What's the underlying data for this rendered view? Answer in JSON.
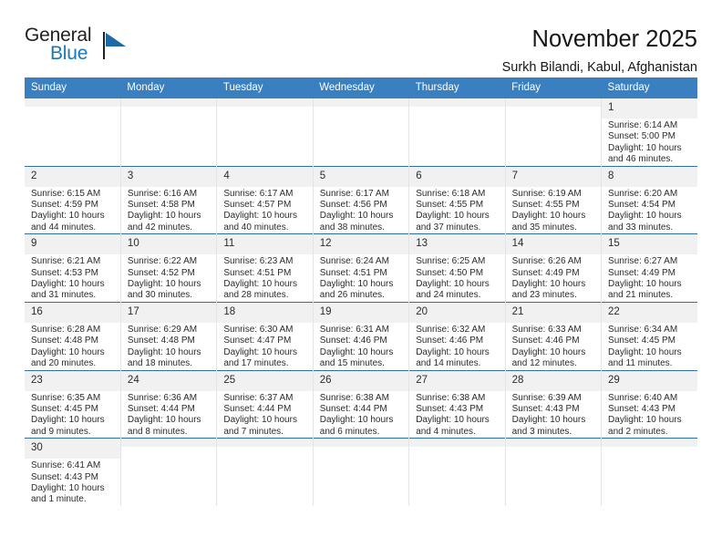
{
  "brand": {
    "name_part1": "General",
    "name_part2": "Blue",
    "mark_icon": "blue-triangle-icon"
  },
  "header": {
    "title": "November 2025",
    "subtitle": "Surkh Bilandi, Kabul, Afghanistan"
  },
  "colors": {
    "header_blue": "#3a7fbf",
    "row_divider_blue": "#2f6da8",
    "daynum_bg": "#f1f1f1",
    "brand_blue": "#1878be",
    "text": "#2b2b2b"
  },
  "calendar": {
    "weekday_headers": [
      "Sunday",
      "Monday",
      "Tuesday",
      "Wednesday",
      "Thursday",
      "Friday",
      "Saturday"
    ],
    "weeks": [
      [
        {
          "day": "",
          "empty": true
        },
        {
          "day": "",
          "empty": true
        },
        {
          "day": "",
          "empty": true
        },
        {
          "day": "",
          "empty": true
        },
        {
          "day": "",
          "empty": true
        },
        {
          "day": "",
          "empty": true
        },
        {
          "day": "1",
          "sunrise": "Sunrise: 6:14 AM",
          "sunset": "Sunset: 5:00 PM",
          "daylight_line1": "Daylight: 10 hours",
          "daylight_line2": "and 46 minutes."
        }
      ],
      [
        {
          "day": "2",
          "sunrise": "Sunrise: 6:15 AM",
          "sunset": "Sunset: 4:59 PM",
          "daylight_line1": "Daylight: 10 hours",
          "daylight_line2": "and 44 minutes."
        },
        {
          "day": "3",
          "sunrise": "Sunrise: 6:16 AM",
          "sunset": "Sunset: 4:58 PM",
          "daylight_line1": "Daylight: 10 hours",
          "daylight_line2": "and 42 minutes."
        },
        {
          "day": "4",
          "sunrise": "Sunrise: 6:17 AM",
          "sunset": "Sunset: 4:57 PM",
          "daylight_line1": "Daylight: 10 hours",
          "daylight_line2": "and 40 minutes."
        },
        {
          "day": "5",
          "sunrise": "Sunrise: 6:17 AM",
          "sunset": "Sunset: 4:56 PM",
          "daylight_line1": "Daylight: 10 hours",
          "daylight_line2": "and 38 minutes."
        },
        {
          "day": "6",
          "sunrise": "Sunrise: 6:18 AM",
          "sunset": "Sunset: 4:55 PM",
          "daylight_line1": "Daylight: 10 hours",
          "daylight_line2": "and 37 minutes."
        },
        {
          "day": "7",
          "sunrise": "Sunrise: 6:19 AM",
          "sunset": "Sunset: 4:55 PM",
          "daylight_line1": "Daylight: 10 hours",
          "daylight_line2": "and 35 minutes."
        },
        {
          "day": "8",
          "sunrise": "Sunrise: 6:20 AM",
          "sunset": "Sunset: 4:54 PM",
          "daylight_line1": "Daylight: 10 hours",
          "daylight_line2": "and 33 minutes."
        }
      ],
      [
        {
          "day": "9",
          "sunrise": "Sunrise: 6:21 AM",
          "sunset": "Sunset: 4:53 PM",
          "daylight_line1": "Daylight: 10 hours",
          "daylight_line2": "and 31 minutes."
        },
        {
          "day": "10",
          "sunrise": "Sunrise: 6:22 AM",
          "sunset": "Sunset: 4:52 PM",
          "daylight_line1": "Daylight: 10 hours",
          "daylight_line2": "and 30 minutes."
        },
        {
          "day": "11",
          "sunrise": "Sunrise: 6:23 AM",
          "sunset": "Sunset: 4:51 PM",
          "daylight_line1": "Daylight: 10 hours",
          "daylight_line2": "and 28 minutes."
        },
        {
          "day": "12",
          "sunrise": "Sunrise: 6:24 AM",
          "sunset": "Sunset: 4:51 PM",
          "daylight_line1": "Daylight: 10 hours",
          "daylight_line2": "and 26 minutes."
        },
        {
          "day": "13",
          "sunrise": "Sunrise: 6:25 AM",
          "sunset": "Sunset: 4:50 PM",
          "daylight_line1": "Daylight: 10 hours",
          "daylight_line2": "and 24 minutes."
        },
        {
          "day": "14",
          "sunrise": "Sunrise: 6:26 AM",
          "sunset": "Sunset: 4:49 PM",
          "daylight_line1": "Daylight: 10 hours",
          "daylight_line2": "and 23 minutes."
        },
        {
          "day": "15",
          "sunrise": "Sunrise: 6:27 AM",
          "sunset": "Sunset: 4:49 PM",
          "daylight_line1": "Daylight: 10 hours",
          "daylight_line2": "and 21 minutes."
        }
      ],
      [
        {
          "day": "16",
          "sunrise": "Sunrise: 6:28 AM",
          "sunset": "Sunset: 4:48 PM",
          "daylight_line1": "Daylight: 10 hours",
          "daylight_line2": "and 20 minutes."
        },
        {
          "day": "17",
          "sunrise": "Sunrise: 6:29 AM",
          "sunset": "Sunset: 4:48 PM",
          "daylight_line1": "Daylight: 10 hours",
          "daylight_line2": "and 18 minutes."
        },
        {
          "day": "18",
          "sunrise": "Sunrise: 6:30 AM",
          "sunset": "Sunset: 4:47 PM",
          "daylight_line1": "Daylight: 10 hours",
          "daylight_line2": "and 17 minutes."
        },
        {
          "day": "19",
          "sunrise": "Sunrise: 6:31 AM",
          "sunset": "Sunset: 4:46 PM",
          "daylight_line1": "Daylight: 10 hours",
          "daylight_line2": "and 15 minutes."
        },
        {
          "day": "20",
          "sunrise": "Sunrise: 6:32 AM",
          "sunset": "Sunset: 4:46 PM",
          "daylight_line1": "Daylight: 10 hours",
          "daylight_line2": "and 14 minutes."
        },
        {
          "day": "21",
          "sunrise": "Sunrise: 6:33 AM",
          "sunset": "Sunset: 4:46 PM",
          "daylight_line1": "Daylight: 10 hours",
          "daylight_line2": "and 12 minutes."
        },
        {
          "day": "22",
          "sunrise": "Sunrise: 6:34 AM",
          "sunset": "Sunset: 4:45 PM",
          "daylight_line1": "Daylight: 10 hours",
          "daylight_line2": "and 11 minutes."
        }
      ],
      [
        {
          "day": "23",
          "sunrise": "Sunrise: 6:35 AM",
          "sunset": "Sunset: 4:45 PM",
          "daylight_line1": "Daylight: 10 hours",
          "daylight_line2": "and 9 minutes."
        },
        {
          "day": "24",
          "sunrise": "Sunrise: 6:36 AM",
          "sunset": "Sunset: 4:44 PM",
          "daylight_line1": "Daylight: 10 hours",
          "daylight_line2": "and 8 minutes."
        },
        {
          "day": "25",
          "sunrise": "Sunrise: 6:37 AM",
          "sunset": "Sunset: 4:44 PM",
          "daylight_line1": "Daylight: 10 hours",
          "daylight_line2": "and 7 minutes."
        },
        {
          "day": "26",
          "sunrise": "Sunrise: 6:38 AM",
          "sunset": "Sunset: 4:44 PM",
          "daylight_line1": "Daylight: 10 hours",
          "daylight_line2": "and 6 minutes."
        },
        {
          "day": "27",
          "sunrise": "Sunrise: 6:38 AM",
          "sunset": "Sunset: 4:43 PM",
          "daylight_line1": "Daylight: 10 hours",
          "daylight_line2": "and 4 minutes."
        },
        {
          "day": "28",
          "sunrise": "Sunrise: 6:39 AM",
          "sunset": "Sunset: 4:43 PM",
          "daylight_line1": "Daylight: 10 hours",
          "daylight_line2": "and 3 minutes."
        },
        {
          "day": "29",
          "sunrise": "Sunrise: 6:40 AM",
          "sunset": "Sunset: 4:43 PM",
          "daylight_line1": "Daylight: 10 hours",
          "daylight_line2": "and 2 minutes."
        }
      ],
      [
        {
          "day": "30",
          "sunrise": "Sunrise: 6:41 AM",
          "sunset": "Sunset: 4:43 PM",
          "daylight_line1": "Daylight: 10 hours",
          "daylight_line2": "and 1 minute."
        },
        {
          "day": "",
          "empty": true
        },
        {
          "day": "",
          "empty": true
        },
        {
          "day": "",
          "empty": true
        },
        {
          "day": "",
          "empty": true
        },
        {
          "day": "",
          "empty": true
        },
        {
          "day": "",
          "empty": true
        }
      ]
    ]
  }
}
